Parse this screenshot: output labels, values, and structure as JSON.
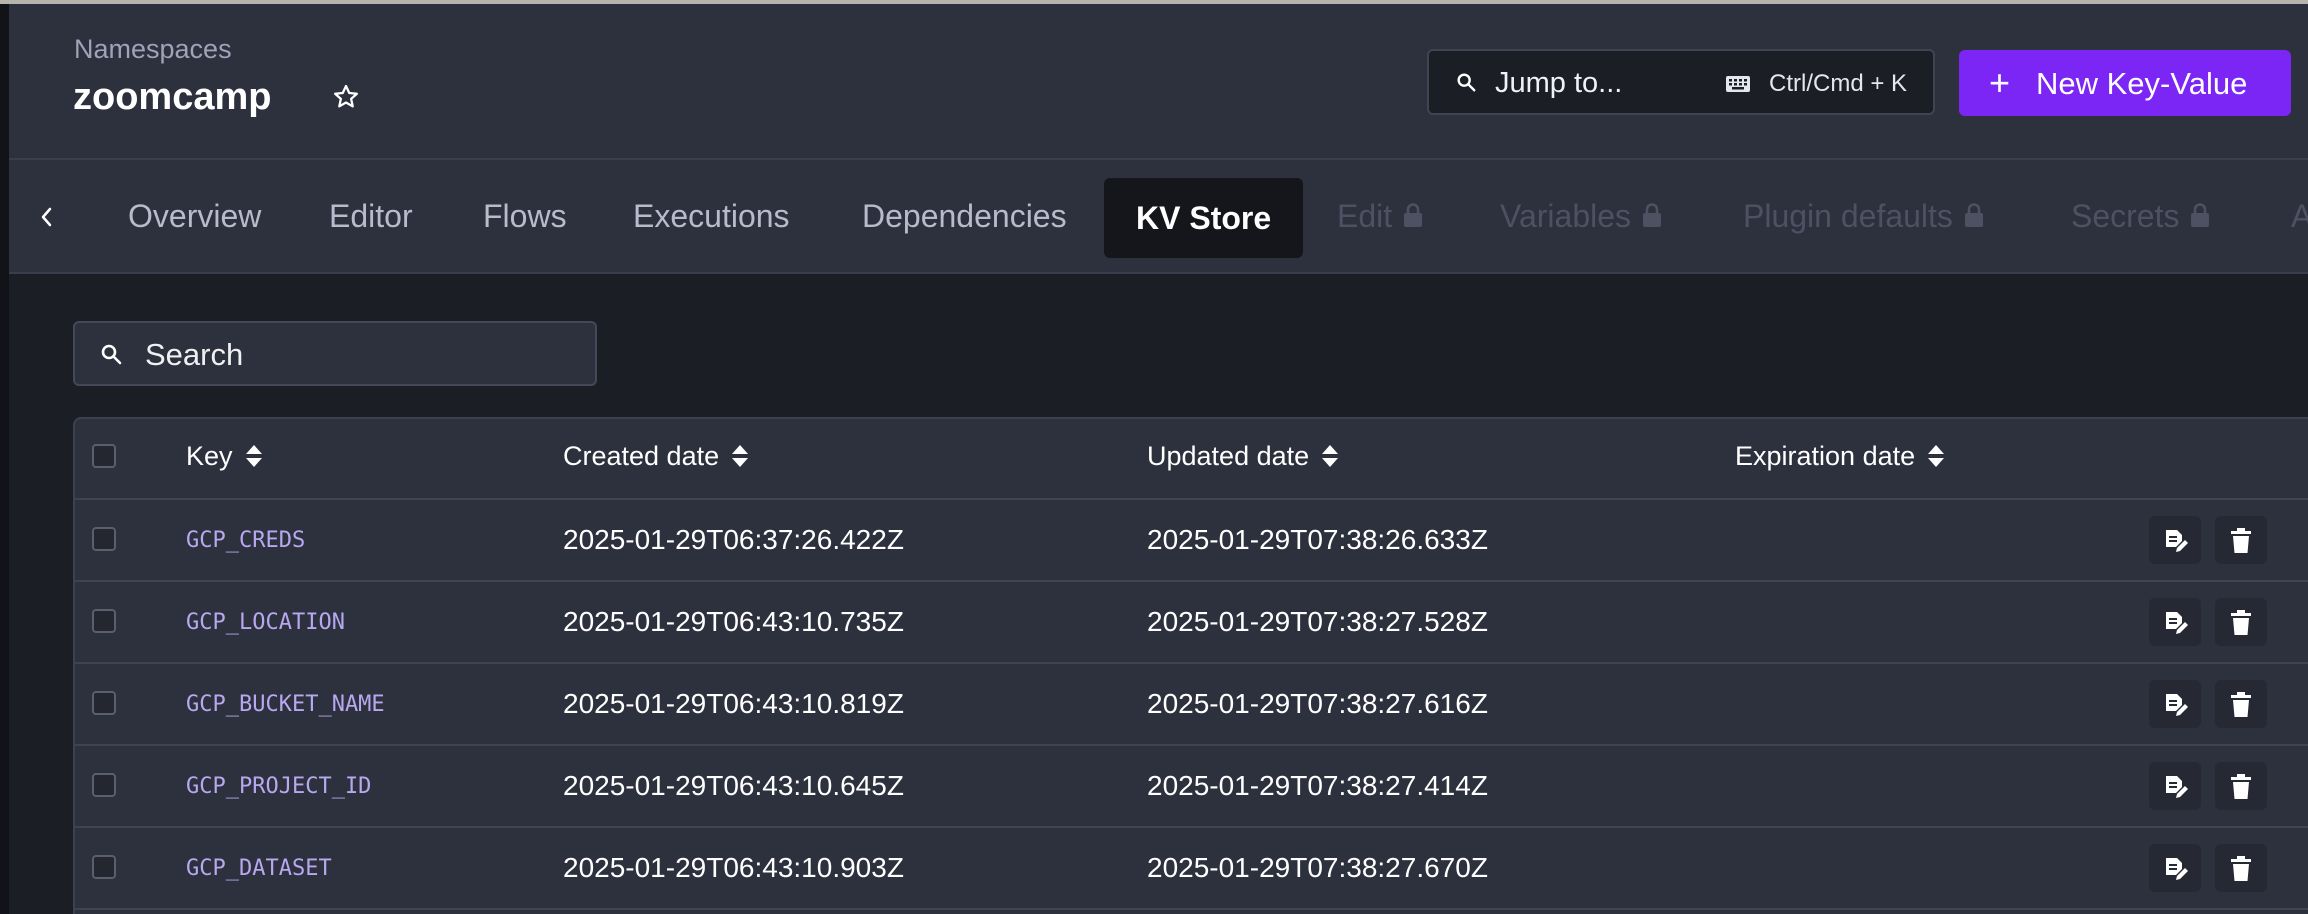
{
  "header": {
    "breadcrumb": "Namespaces",
    "title": "zoomcamp",
    "jump": {
      "label": "Jump to...",
      "shortcut": "Ctrl/Cmd + K"
    },
    "new_button": {
      "plus": "+",
      "label": "New Key-Value"
    }
  },
  "tabs": [
    {
      "label": "Overview",
      "state": "normal"
    },
    {
      "label": "Editor",
      "state": "normal"
    },
    {
      "label": "Flows",
      "state": "normal"
    },
    {
      "label": "Executions",
      "state": "normal"
    },
    {
      "label": "Dependencies",
      "state": "normal"
    },
    {
      "label": "KV Store",
      "state": "active"
    },
    {
      "label": "Edit",
      "state": "locked"
    },
    {
      "label": "Variables",
      "state": "locked"
    },
    {
      "label": "Plugin defaults",
      "state": "locked"
    },
    {
      "label": "Secrets",
      "state": "locked"
    },
    {
      "label": "A",
      "state": "locked"
    }
  ],
  "search": {
    "placeholder": "Search"
  },
  "table": {
    "columns": [
      "Key",
      "Created date",
      "Updated date",
      "Expiration date"
    ],
    "rows": [
      {
        "key": "GCP_CREDS",
        "created": "2025-01-29T06:37:26.422Z",
        "updated": "2025-01-29T07:38:26.633Z",
        "expiration": ""
      },
      {
        "key": "GCP_LOCATION",
        "created": "2025-01-29T06:43:10.735Z",
        "updated": "2025-01-29T07:38:27.528Z",
        "expiration": ""
      },
      {
        "key": "GCP_BUCKET_NAME",
        "created": "2025-01-29T06:43:10.819Z",
        "updated": "2025-01-29T07:38:27.616Z",
        "expiration": ""
      },
      {
        "key": "GCP_PROJECT_ID",
        "created": "2025-01-29T06:43:10.645Z",
        "updated": "2025-01-29T07:38:27.414Z",
        "expiration": ""
      },
      {
        "key": "GCP_DATASET",
        "created": "2025-01-29T06:43:10.903Z",
        "updated": "2025-01-29T07:38:27.670Z",
        "expiration": ""
      }
    ]
  },
  "icons": {
    "favorite": "star-outline-icon",
    "search": "magnifier-icon",
    "keyboard": "keyboard-icon",
    "tab_scroll": "chevron-left-icon",
    "locked": "lock-icon",
    "sort": "sort-icon",
    "edit": "file-edit-icon",
    "delete": "trash-icon"
  },
  "colors": {
    "accent": "#7c26f5",
    "surface": "#2d303d",
    "background": "#1c1e26",
    "key_text": "#b7a8ef"
  }
}
